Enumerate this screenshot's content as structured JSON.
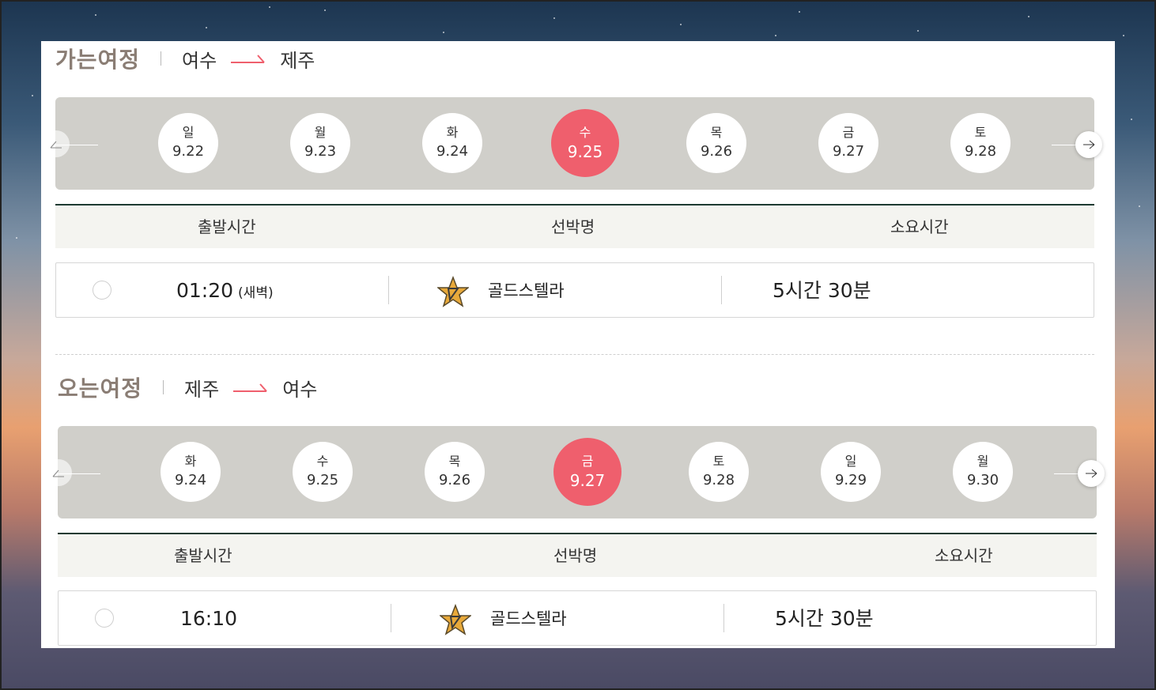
{
  "outbound": {
    "title": "가는여정",
    "from": "여수",
    "to": "제주",
    "days": [
      {
        "dow": "일",
        "date": "9.22"
      },
      {
        "dow": "월",
        "date": "9.23"
      },
      {
        "dow": "화",
        "date": "9.24"
      },
      {
        "dow": "수",
        "date": "9.25"
      },
      {
        "dow": "목",
        "date": "9.26"
      },
      {
        "dow": "금",
        "date": "9.27"
      },
      {
        "dow": "토",
        "date": "9.28"
      }
    ],
    "selected_date": "9.25",
    "table_headers": {
      "depart": "출발시간",
      "ship": "선박명",
      "duration": "소요시간"
    },
    "schedule": {
      "time": "01:20",
      "time_note": "(새벽)",
      "ship": "골드스텔라",
      "duration": "5시간 30분"
    }
  },
  "inbound": {
    "title": "오는여정",
    "from": "제주",
    "to": "여수",
    "days": [
      {
        "dow": "화",
        "date": "9.24"
      },
      {
        "dow": "수",
        "date": "9.25"
      },
      {
        "dow": "목",
        "date": "9.26"
      },
      {
        "dow": "금",
        "date": "9.27"
      },
      {
        "dow": "토",
        "date": "9.28"
      },
      {
        "dow": "일",
        "date": "9.29"
      },
      {
        "dow": "월",
        "date": "9.30"
      }
    ],
    "selected_date": "9.27",
    "table_headers": {
      "depart": "출발시간",
      "ship": "선박명",
      "duration": "소요시간"
    },
    "schedule": {
      "time": "16:10",
      "time_note": "",
      "ship": "골드스텔라",
      "duration": "5시간 30분"
    }
  },
  "icons": {
    "route_arrow": "right-arrow-icon",
    "prev": "arrow-left-icon",
    "next": "arrow-right-icon",
    "ship_logo": "gold-star-logo-icon"
  },
  "colors": {
    "accent": "#ef5f6d",
    "title": "#8a7d74",
    "date_bar": "#d0cfca",
    "table_border": "#1e3a32",
    "logo_gold": "#e8a93a"
  }
}
